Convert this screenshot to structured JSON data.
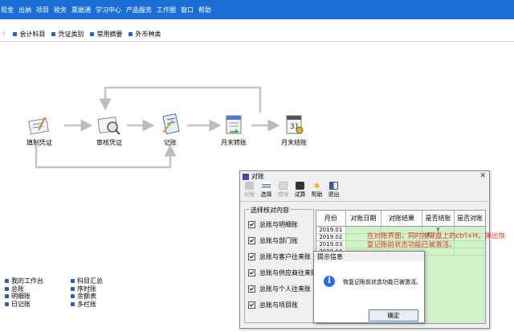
{
  "menu": [
    "现金",
    "出纳",
    "项目",
    "税务",
    "票据通",
    "学习中心",
    "产品服务",
    "工作圈",
    "窗口",
    "帮助"
  ],
  "toolbar": [
    "会计科目",
    "凭证类别",
    "常用摘要",
    "外币种类"
  ],
  "flow": {
    "nodes": [
      "填制凭证",
      "审核凭证",
      "记账",
      "月末转账",
      "月末结账"
    ]
  },
  "quick_left": [
    "我的工作台",
    "总账",
    "明细账",
    "日记账"
  ],
  "quick_right": [
    "科目汇总",
    "序时账",
    "余额表",
    "多栏账"
  ],
  "reconcile_window": {
    "title": "对账",
    "tools": [
      {
        "label": "对账",
        "icon": "reconcile-icon",
        "enabled": false
      },
      {
        "label": "选择",
        "icon": "select-icon",
        "enabled": true
      },
      {
        "label": "错误",
        "icon": "error-icon",
        "enabled": false
      },
      {
        "label": "试算",
        "icon": "trial-balance-icon",
        "enabled": true
      },
      {
        "label": "帮助",
        "icon": "help-icon",
        "enabled": true
      },
      {
        "label": "退出",
        "icon": "exit-icon",
        "enabled": true
      }
    ],
    "group_title": "选择核对内容",
    "options": [
      "总账与明细账",
      "总账与部门账",
      "总账与客户往来账",
      "总账与供应商往来账",
      "总账与个人往来账",
      "总账与项目账"
    ],
    "columns": [
      "月份",
      "对账日期",
      "对账结果",
      "是否结账",
      "是否对账"
    ],
    "rows": [
      [
        "2019.01",
        "",
        "",
        "Y",
        ""
      ],
      [
        "2019.02",
        "",
        "",
        "",
        ""
      ],
      [
        "2019.03",
        "",
        "",
        "",
        ""
      ],
      [
        "2019.04",
        "",
        "",
        "",
        ""
      ]
    ]
  },
  "note": "在对账界面，同时按键盘上的ctrl+H，弹出恢复记账前状态功能已被激活。",
  "message_box": {
    "title": "提示信息",
    "text": "恢复记账前状态功能已被激活。",
    "button": "确定"
  },
  "colors": {
    "menubar": "#1a6fd4",
    "grid_bg": "#d0f2c9",
    "note": "#e8322a"
  }
}
